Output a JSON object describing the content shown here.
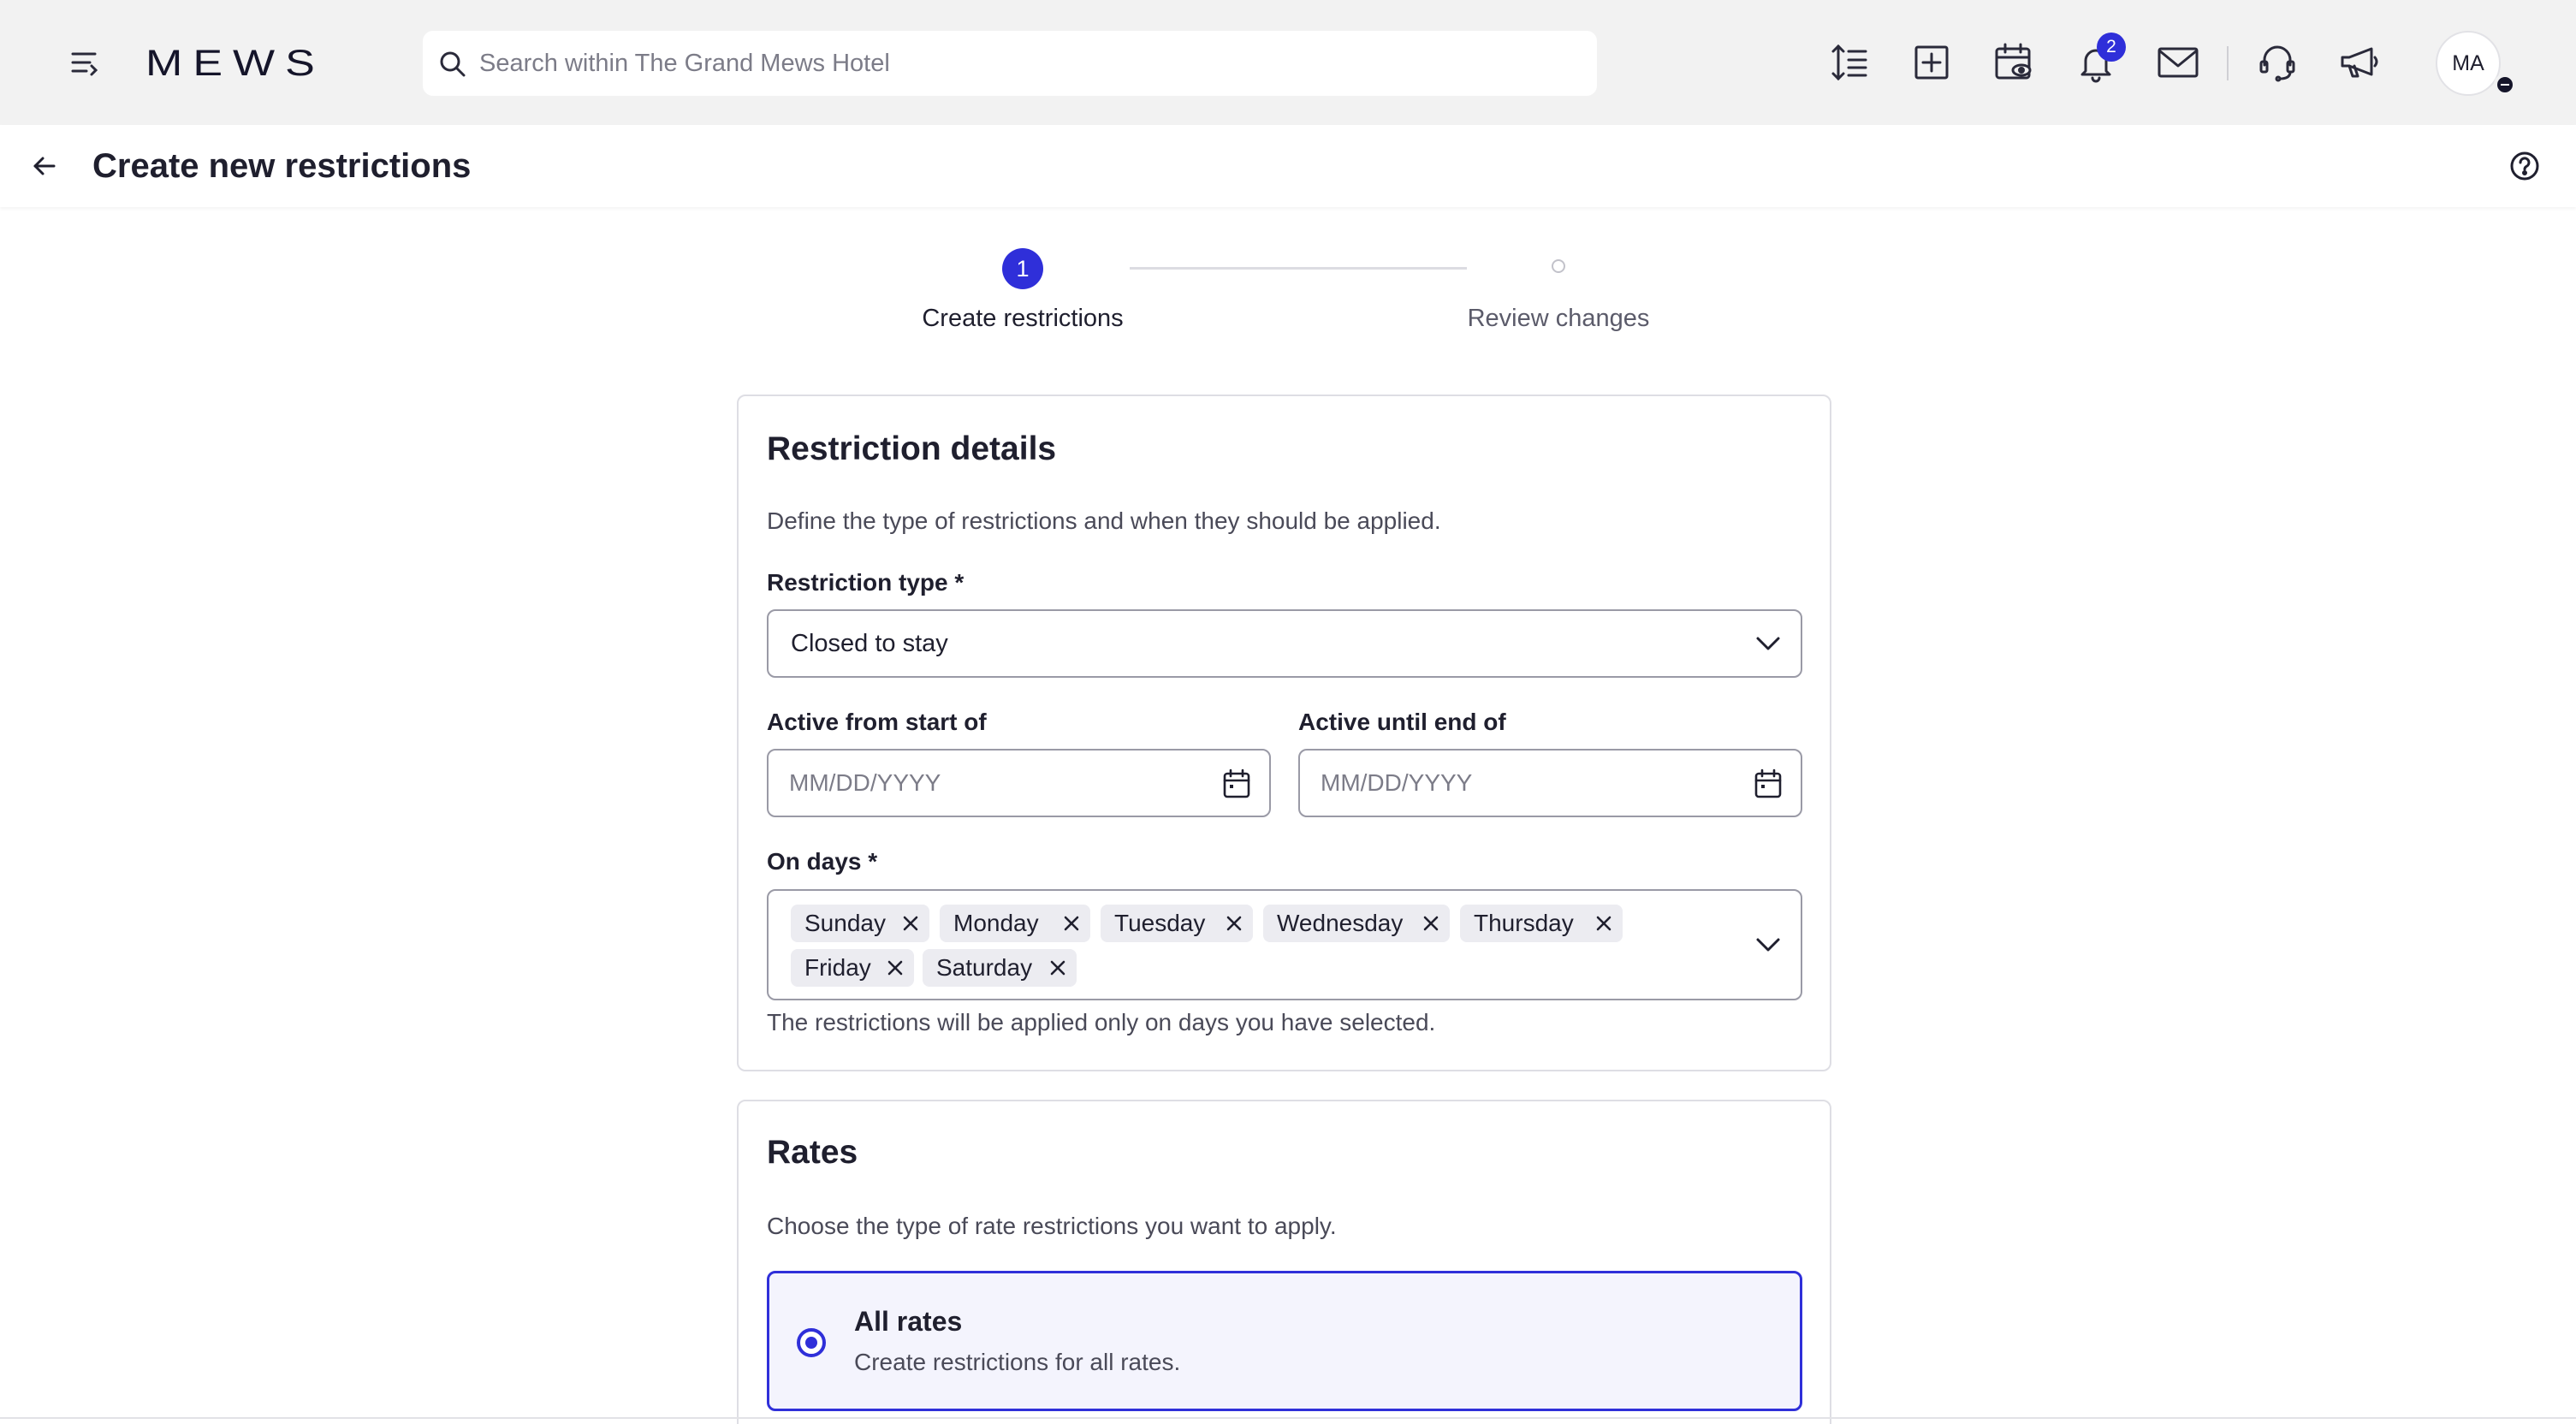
{
  "topbar": {
    "logo": "MEWS",
    "search_placeholder": "Search within The Grand Mews Hotel",
    "notifications_count": "2",
    "avatar_initials": "MA"
  },
  "page": {
    "title": "Create new restrictions"
  },
  "stepper": {
    "step1_number": "1",
    "step1_label": "Create restrictions",
    "step2_label": "Review changes"
  },
  "restriction_details": {
    "title": "Restriction details",
    "description": "Define the type of restrictions and when they should be applied.",
    "type_label": "Restriction type *",
    "type_value": "Closed to stay",
    "active_from_label": "Active from start of",
    "active_from_placeholder": "MM/DD/YYYY",
    "active_until_label": "Active until end of",
    "active_until_placeholder": "MM/DD/YYYY",
    "days_label": "On days *",
    "days": [
      "Sunday",
      "Monday",
      "Tuesday",
      "Wednesday",
      "Thursday",
      "Friday",
      "Saturday"
    ],
    "days_helper": "The restrictions will be applied only on days you have selected."
  },
  "rates": {
    "title": "Rates",
    "description": "Choose the type of rate restrictions you want to apply.",
    "option_title": "All rates",
    "option_desc": "Create restrictions for all rates."
  },
  "colors": {
    "accent": "#2f2fd9",
    "topbar_bg": "#f2f2f2",
    "border": "#9a9aa6"
  }
}
